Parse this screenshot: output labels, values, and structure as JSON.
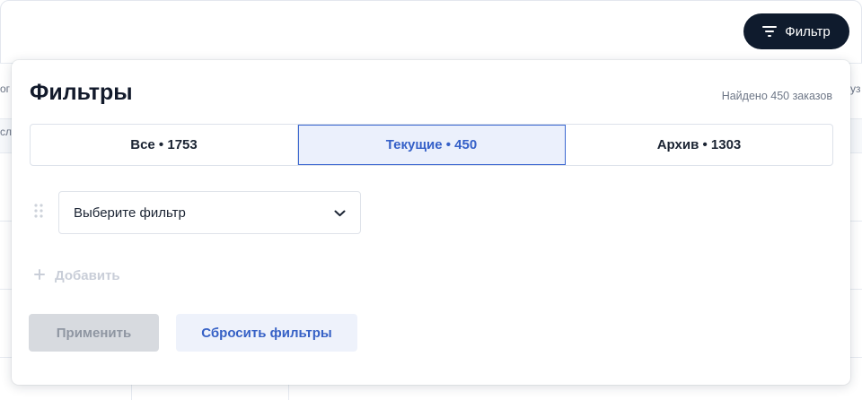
{
  "toolbar": {
    "filter_button_label": "Фильтр",
    "filter_icon": "filter-lines-icon"
  },
  "background_table": {
    "fragments": [
      "ог",
      "сл",
      "уз"
    ]
  },
  "panel": {
    "title": "Фильтры",
    "found_text": "Найдено 450 заказов",
    "tabs": [
      {
        "label": "Все • 1753",
        "active": false
      },
      {
        "label": "Текущие • 450",
        "active": true
      },
      {
        "label": "Архив • 1303",
        "active": false
      }
    ],
    "filter_select": {
      "placeholder": "Выберите фильтр",
      "drag_icon": "drag-handle-icon",
      "chevron_icon": "chevron-down-icon"
    },
    "add_label": "Добавить",
    "add_icon": "plus-icon",
    "apply_label": "Применить",
    "reset_label": "Сбросить фильтры"
  },
  "colors": {
    "dark_button": "#0f1b2d",
    "accent": "#3560c8",
    "active_tab_bg": "#ebf0fc",
    "disabled_button": "#d7dadf"
  }
}
